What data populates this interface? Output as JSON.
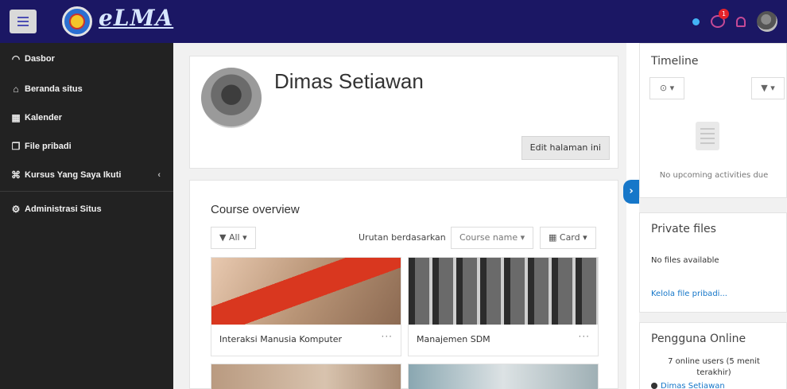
{
  "navbar": {
    "brand": "eLMA",
    "notification_count": "1"
  },
  "sidebar": {
    "items": [
      {
        "label": "Dasbor",
        "icon": "dashboard-icon"
      },
      {
        "label": "Beranda situs",
        "icon": "home-icon"
      },
      {
        "label": "Kalender",
        "icon": "calendar-icon"
      },
      {
        "label": "File pribadi",
        "icon": "file-icon"
      },
      {
        "label": "Kursus Yang Saya Ikuti",
        "icon": "graduation-cap-icon"
      },
      {
        "label": "Administrasi Situs",
        "icon": "gear-icon"
      }
    ]
  },
  "profile": {
    "name": "Dimas Setiawan",
    "edit_label": "Edit halaman ini"
  },
  "course_overview": {
    "title": "Course overview",
    "filter_label": "▼ All ▾",
    "sort_label": "Urutan berdasarkan",
    "sort_value": "Course name ▾",
    "view_value": "▦ Card ▾",
    "courses": [
      {
        "name": "Interaksi Manusia Komputer"
      },
      {
        "name": "Manajemen SDM"
      },
      {
        "name": ""
      },
      {
        "name": ""
      }
    ]
  },
  "timeline": {
    "title": "Timeline",
    "sort_btn": "⊙ ▾",
    "filter_btn": "▼ ▾",
    "empty_text": "No upcoming activities due"
  },
  "private_files": {
    "title": "Private files",
    "empty_text": "No files available",
    "manage_link": "Kelola file pribadi..."
  },
  "online_users": {
    "title": "Pengguna Online",
    "summary": "7 online users (5 menit terakhir)",
    "first_user": "Dimas Setiawan"
  }
}
